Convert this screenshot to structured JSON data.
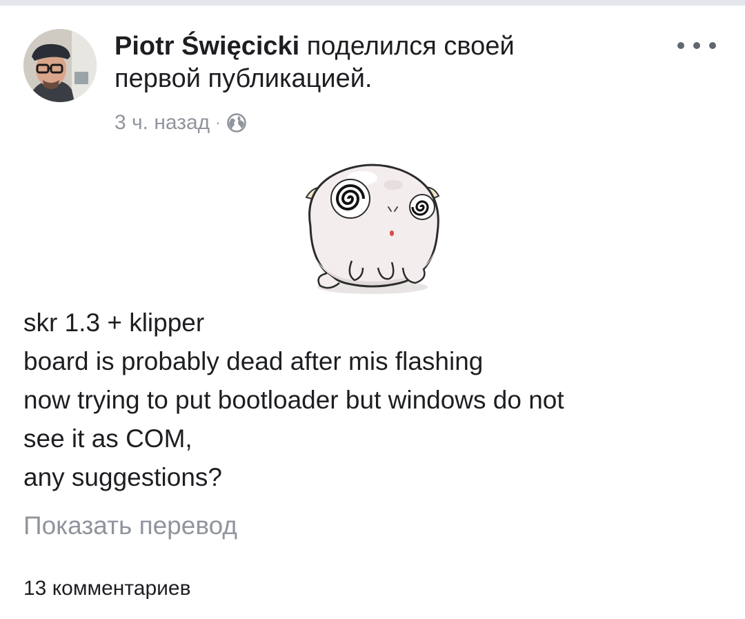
{
  "header": {
    "author_name": "Piotr Święcicki",
    "action_line_1": " поделился своей",
    "action_line_2": "первой публикацией.",
    "timestamp": "3 ч. назад",
    "separator": "·",
    "privacy_icon": "globe-icon",
    "more_icon": "more-options-icon"
  },
  "avatar": {
    "icon": "user-photo"
  },
  "sticker": {
    "icon": "dizzy-cartoon-sticker"
  },
  "post": {
    "lines": [
      "skr 1.3 +  klipper",
      "board is probably dead after mis flashing",
      "now trying to put bootloader but windows do not",
      "see it as COM,",
      "any suggestions?"
    ],
    "show_translation": "Показать перевод"
  },
  "footer": {
    "comments_count": "13 комментариев"
  },
  "colors": {
    "text_primary": "#1c1e21",
    "text_secondary": "#90949c",
    "top_bar": "#e4e6eb"
  }
}
